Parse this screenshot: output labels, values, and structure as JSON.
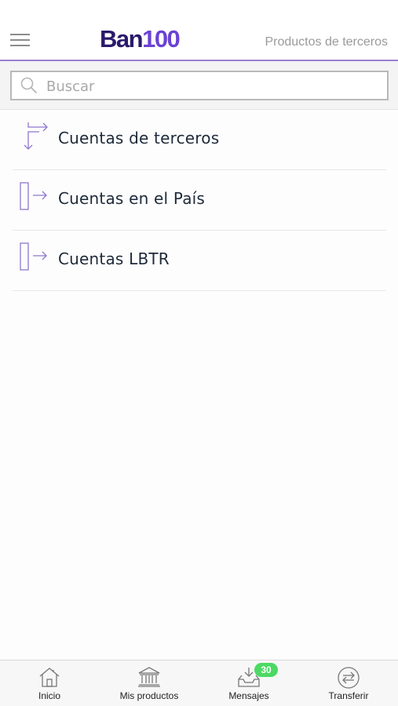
{
  "header": {
    "logo_part1": "Ban",
    "logo_part2": "100",
    "title_link": "Productos de terceros"
  },
  "search": {
    "placeholder": "Buscar",
    "value": ""
  },
  "items": [
    {
      "label": "Cuentas de terceros",
      "icon": "transfer-corner-arrows-icon"
    },
    {
      "label": "Cuentas en el País",
      "icon": "account-arrow-icon"
    },
    {
      "label": "Cuentas LBTR",
      "icon": "account-arrow-icon"
    }
  ],
  "tabbar": {
    "tabs": [
      {
        "label": "Inicio",
        "icon": "home-icon"
      },
      {
        "label": "Mis productos",
        "icon": "bank-icon"
      },
      {
        "label": "Mensajes",
        "icon": "inbox-icon",
        "badge": "30"
      },
      {
        "label": "Transferir",
        "icon": "transfer-icon"
      }
    ]
  },
  "colors": {
    "accent": "#9b7fd1",
    "logo_dark": "#2a1a6b",
    "logo_purple": "#6a42d4",
    "badge": "#4cd964"
  }
}
